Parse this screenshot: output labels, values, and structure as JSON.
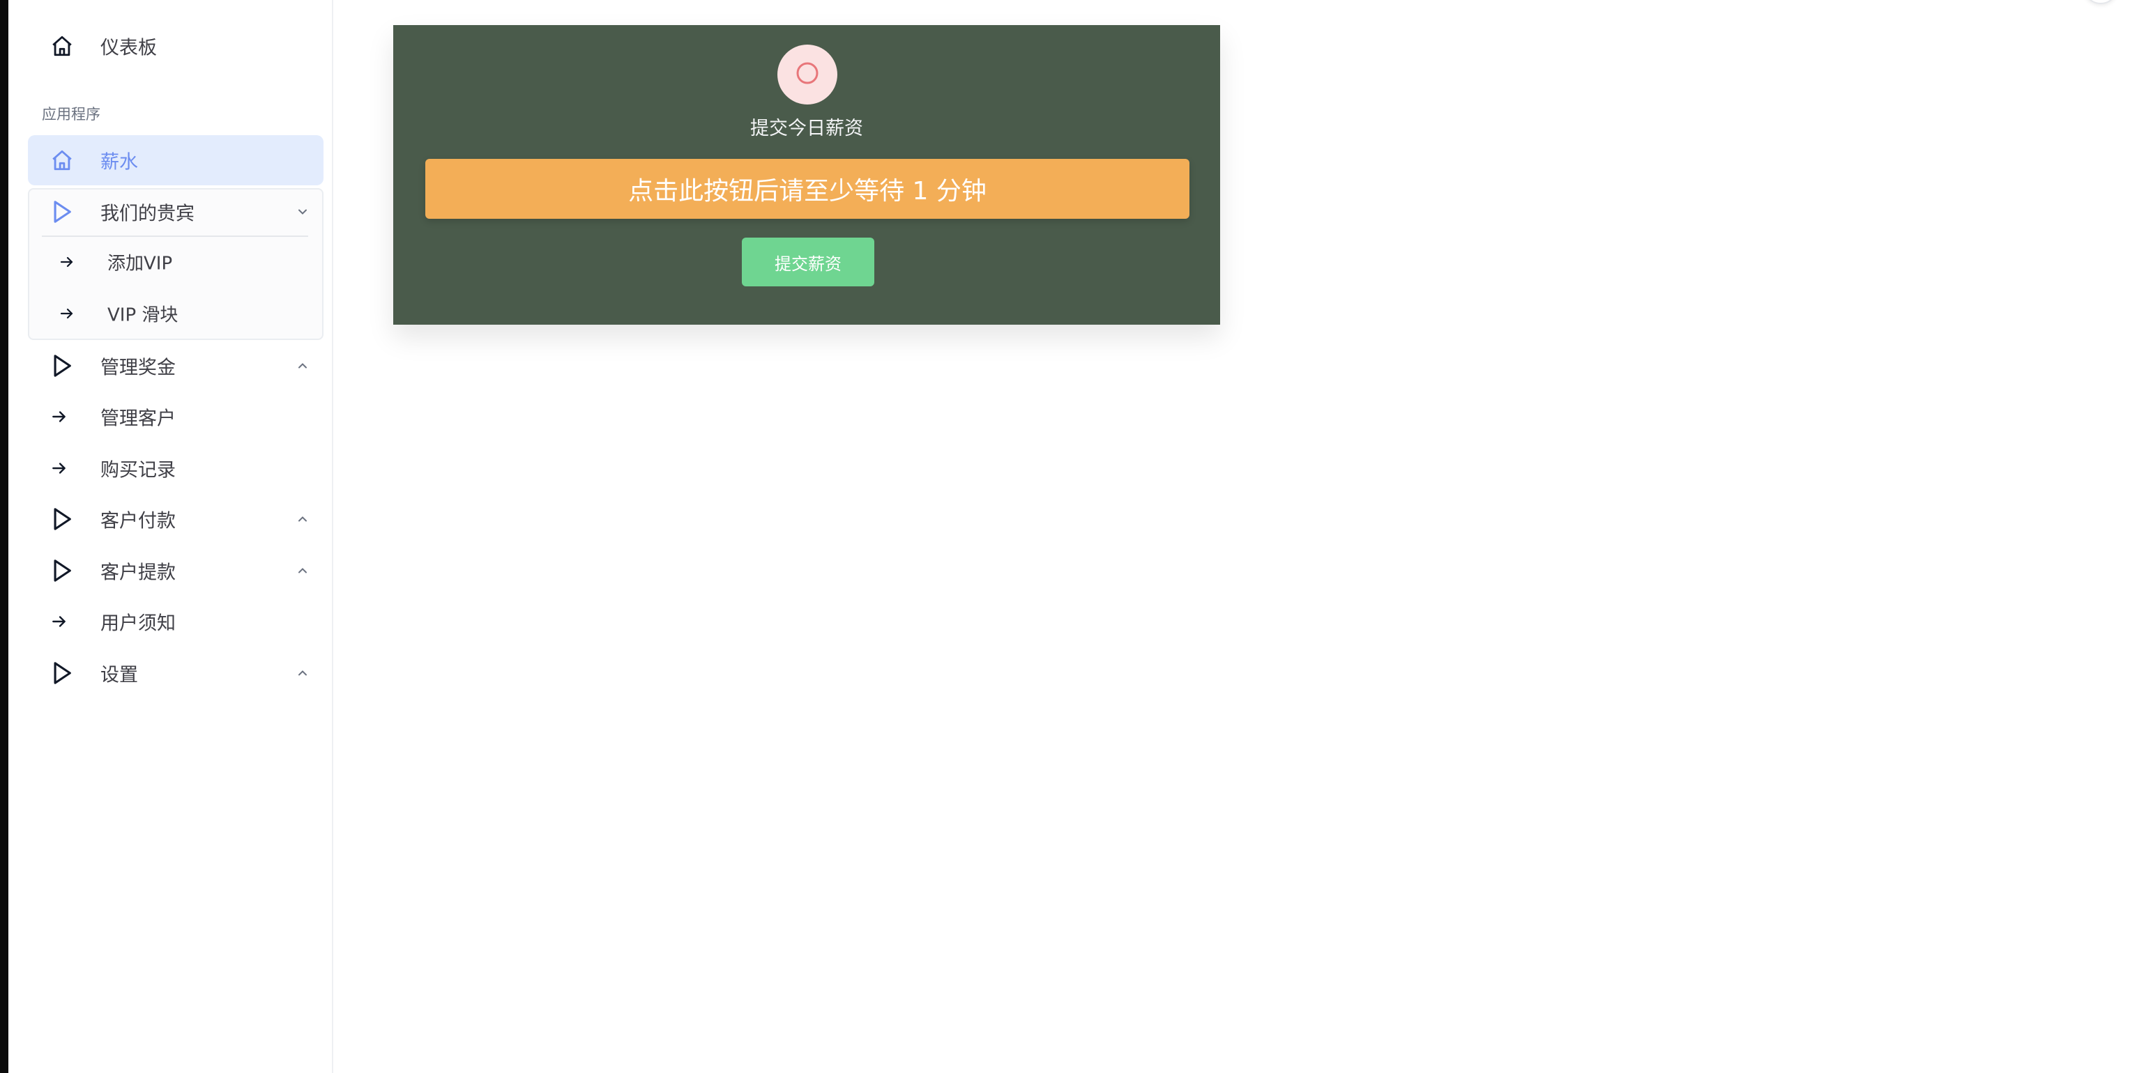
{
  "sidebar": {
    "dashboard_label": "仪表板",
    "section_title": "应用程序",
    "items": [
      {
        "label": "薪水",
        "icon": "home-icon",
        "active": true
      },
      {
        "label": "我们的贵宾",
        "icon": "play-outline-icon",
        "expanded": true,
        "children": [
          {
            "label": "添加VIP",
            "icon": "arrow-right-icon"
          },
          {
            "label": "VIP 滑块",
            "icon": "arrow-right-icon"
          }
        ]
      },
      {
        "label": "管理奖金",
        "icon": "play-outline-icon",
        "expanded": false
      },
      {
        "label": "管理客户",
        "icon": "arrow-right-icon"
      },
      {
        "label": "购买记录",
        "icon": "arrow-right-icon"
      },
      {
        "label": "客户付款",
        "icon": "play-outline-icon",
        "expanded": false
      },
      {
        "label": "客户提款",
        "icon": "play-outline-icon",
        "expanded": false
      },
      {
        "label": "用户须知",
        "icon": "arrow-right-icon"
      },
      {
        "label": "设置",
        "icon": "play-outline-icon",
        "expanded": false
      }
    ]
  },
  "main": {
    "card": {
      "title": "提交今日薪资",
      "warning": "点击此按钮后请至少等待 1 分钟",
      "submit_label": "提交薪资",
      "icon": "circle-outline-icon"
    }
  },
  "colors": {
    "card_bg": "#4a5b4b",
    "warning_bg": "#f3ae57",
    "submit_bg": "#6fd591",
    "active_bg": "#e3ecfd",
    "active_text": "#6c8df0",
    "icon_ring": "#e8767a"
  }
}
